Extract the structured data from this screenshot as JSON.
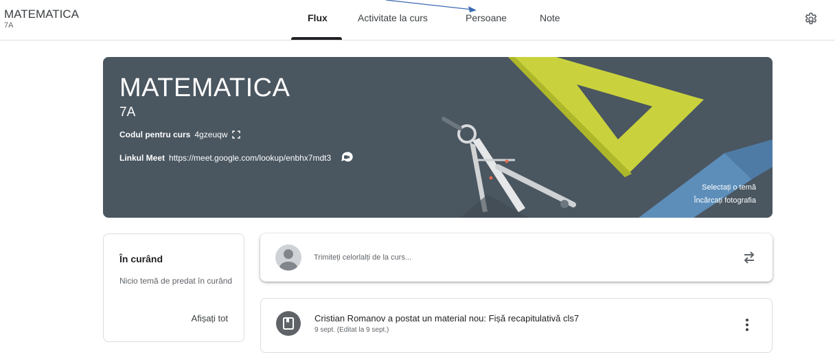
{
  "header": {
    "course_title": "MATEMATICA",
    "course_section": "7A",
    "tabs": [
      {
        "label": "Flux",
        "active": true
      },
      {
        "label": "Activitate la curs",
        "active": false
      },
      {
        "label": "Persoane",
        "active": false
      },
      {
        "label": "Note",
        "active": false
      }
    ],
    "settings_icon": "gear-icon"
  },
  "banner": {
    "title": "MATEMATICA",
    "section": "7A",
    "code_label": "Codul pentru curs",
    "code_value": "4gzeuqw",
    "meet_label": "Linkul Meet",
    "meet_url": "https://meet.google.com/lookup/enbhx7mdt3",
    "select_theme": "Selectați o temă",
    "upload_photo": "Încărcați fotografia",
    "background_color": "#4a5660"
  },
  "upcoming": {
    "title": "În curând",
    "empty_text": "Nicio temă de predat în curând",
    "view_all": "Afișați tot"
  },
  "composer": {
    "placeholder": "Trimiteți celorlalți de la curs..."
  },
  "posts": [
    {
      "title": "Cristian Romanov a postat un material nou: Fișă recapitulativă cls7",
      "date": "9 sept. (Editat la 9 sept.)"
    }
  ],
  "colors": {
    "annotation_arrow": "#3a6ab0",
    "ruler_yellow": "#c9d23c",
    "ruler_blue": "#5f95c4"
  }
}
